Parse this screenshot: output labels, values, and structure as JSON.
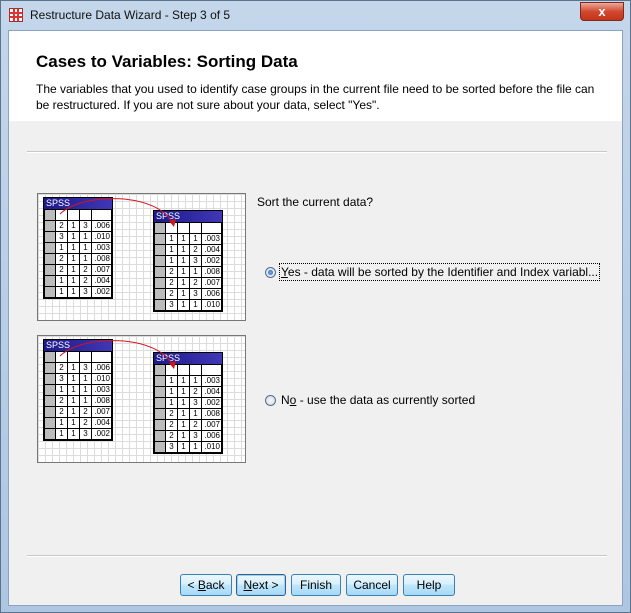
{
  "window": {
    "title": "Restructure Data Wizard - Step 3 of 5",
    "close_glyph": "x"
  },
  "header": {
    "title": "Cases to Variables: Sorting Data",
    "description": "The variables that you used to identify case groups in the current file need to be sorted before the file can be restructured.  If you are not sure about your data, select \"Yes\"."
  },
  "prompt": "Sort the current data?",
  "illustration_label": "SPSS",
  "illustration_source": [
    [
      "2",
      "1",
      "3",
      ".006"
    ],
    [
      "3",
      "1",
      "1",
      ".010"
    ],
    [
      "1",
      "1",
      "1",
      ".003"
    ],
    [
      "2",
      "1",
      "1",
      ".008"
    ],
    [
      "2",
      "1",
      "2",
      ".007"
    ],
    [
      "1",
      "1",
      "2",
      ".004"
    ],
    [
      "1",
      "1",
      "3",
      ".002"
    ]
  ],
  "illustration_sorted": [
    [
      "1",
      "1",
      "1",
      ".003"
    ],
    [
      "1",
      "1",
      "2",
      ".004"
    ],
    [
      "1",
      "1",
      "3",
      ".002"
    ],
    [
      "2",
      "1",
      "1",
      ".008"
    ],
    [
      "2",
      "1",
      "2",
      ".007"
    ],
    [
      "2",
      "1",
      "3",
      ".006"
    ],
    [
      "3",
      "1",
      "1",
      ".010"
    ]
  ],
  "options": {
    "yes": {
      "mnemonic": "Y",
      "rest": "es - data will be sorted by the Identifier and Index variabl...",
      "selected": true
    },
    "no": {
      "pre": "N",
      "mnemonic": "o",
      "rest": " - use the data as currently sorted",
      "selected": false
    }
  },
  "buttons": {
    "back": {
      "pre": "< ",
      "mnemonic": "B",
      "rest": "ack"
    },
    "next": {
      "mnemonic": "N",
      "rest": "ext >"
    },
    "finish": "Finish",
    "cancel": "Cancel",
    "help": "Help"
  }
}
